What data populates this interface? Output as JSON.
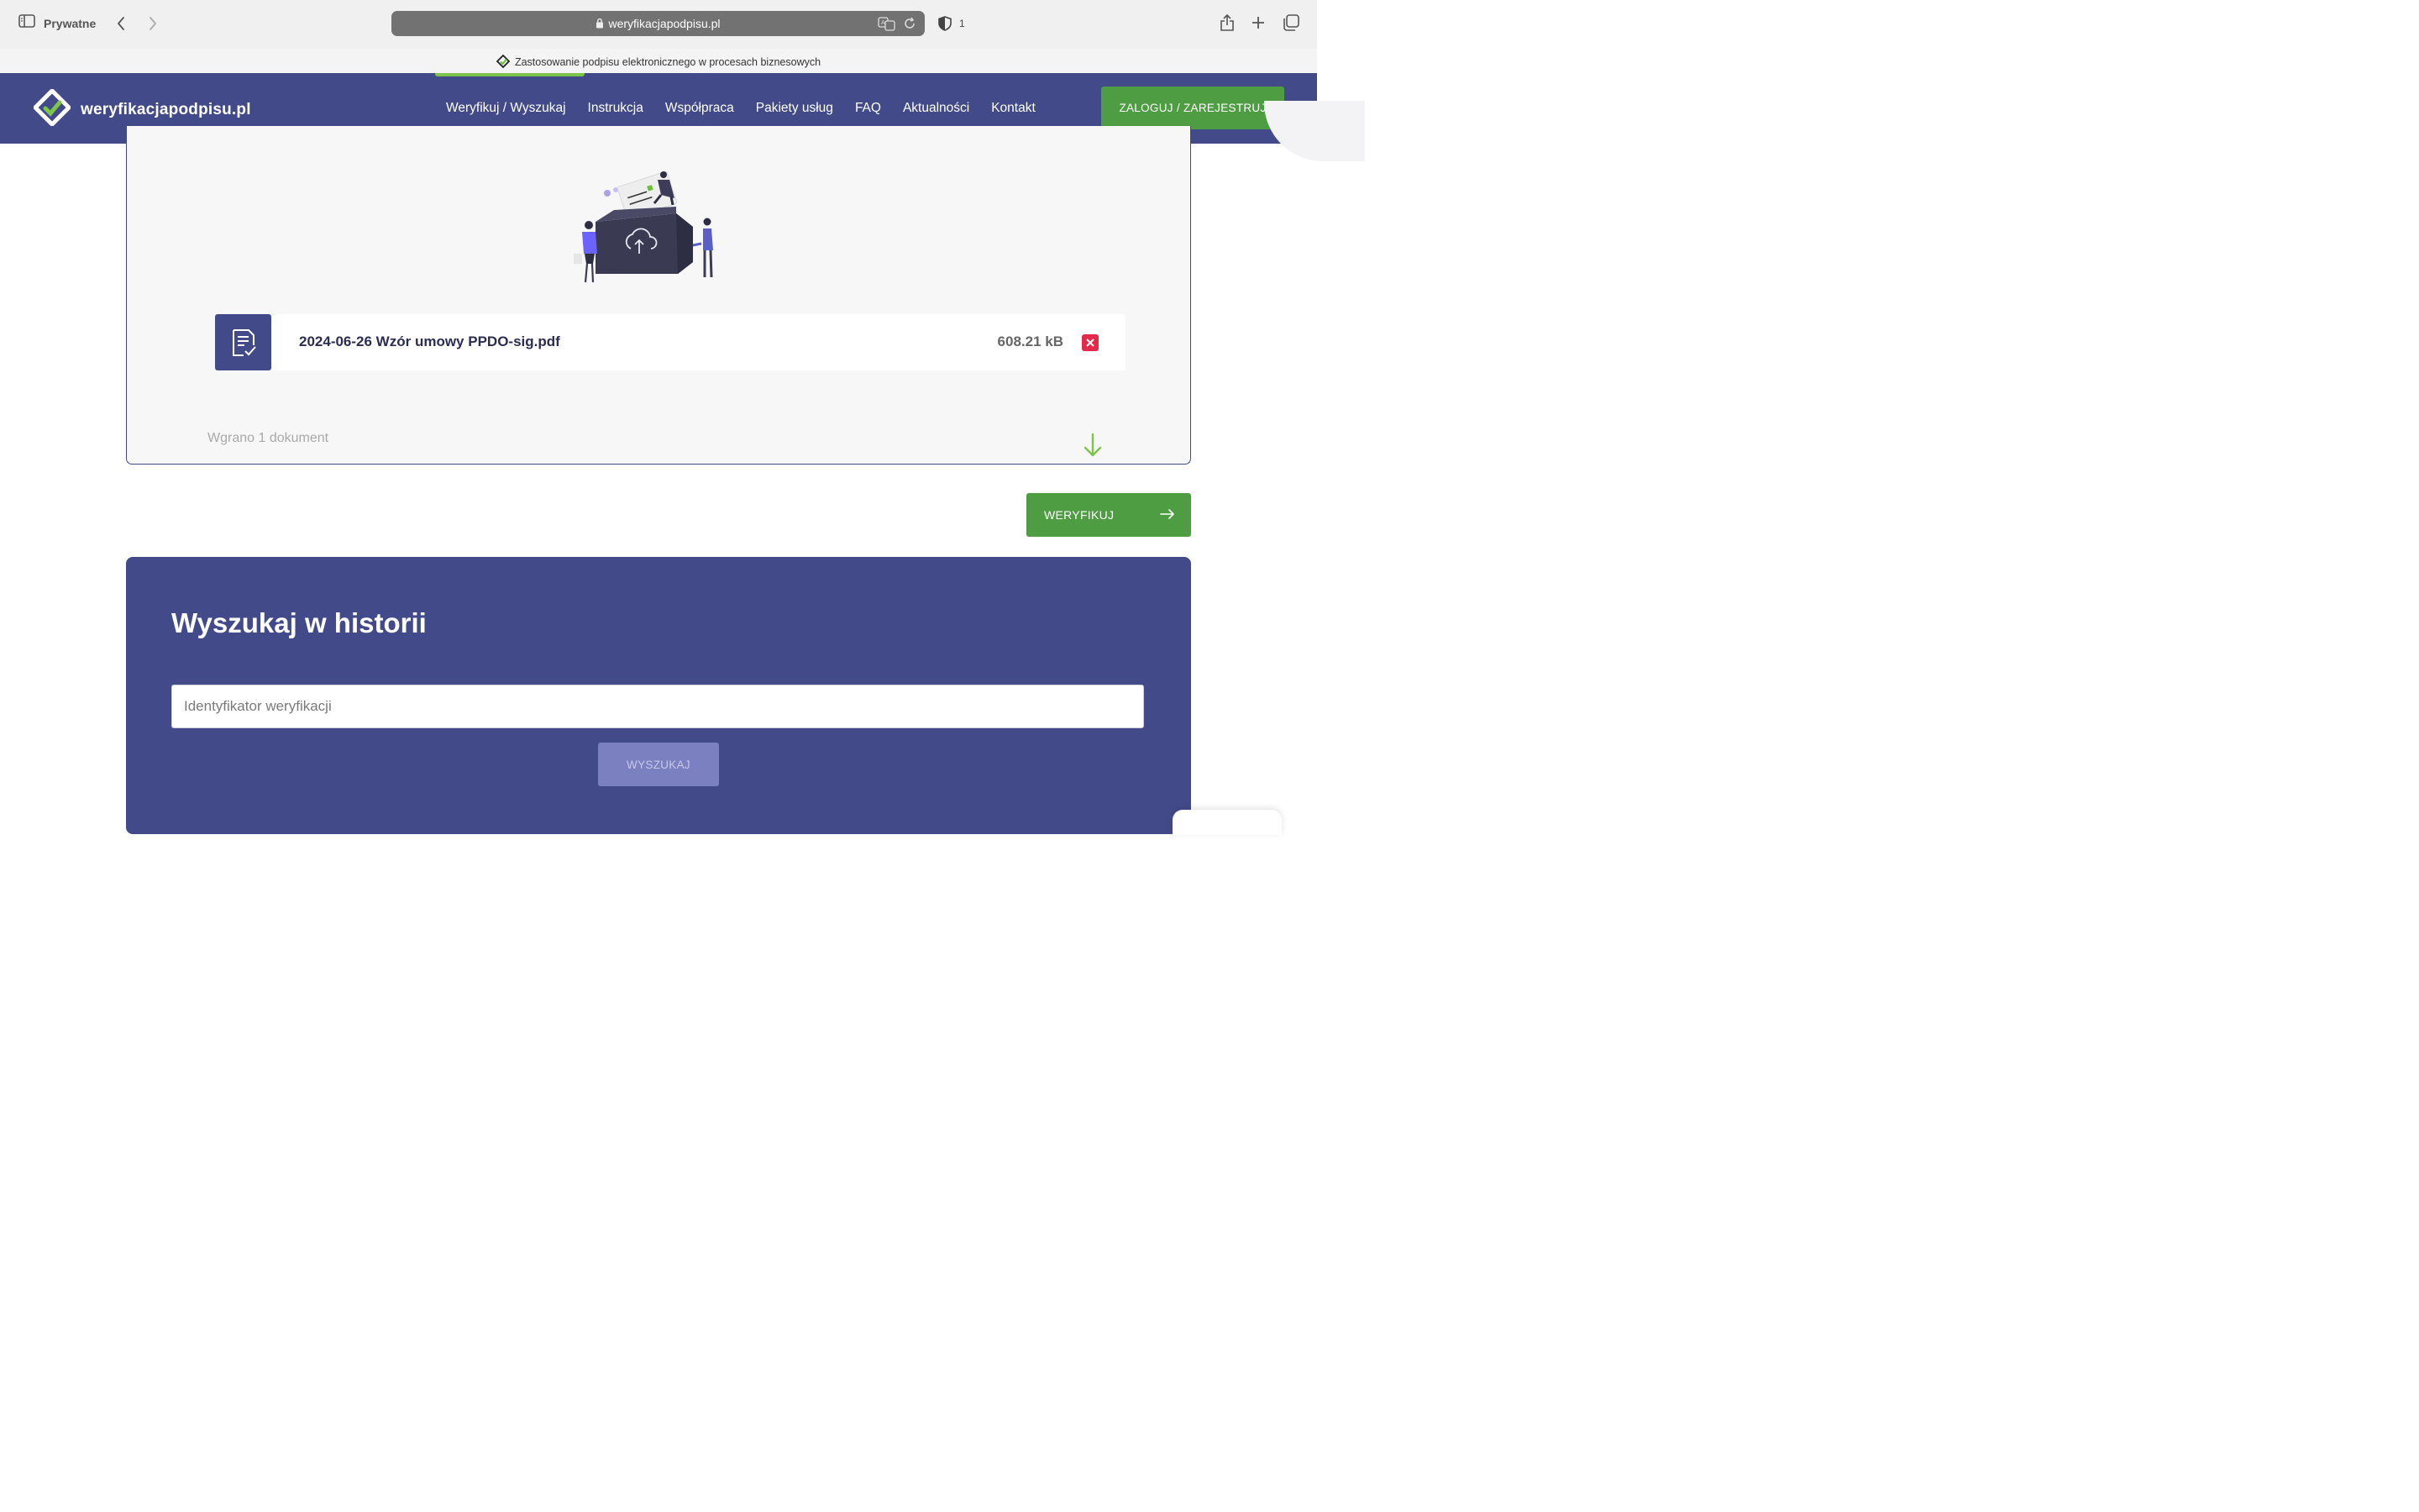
{
  "browser": {
    "profile_label": "Prywatne",
    "url": "weryfikacjapodpisu.pl",
    "shield_count": "1",
    "tab_title": "Zastosowanie podpisu elektronicznego w procesach biznesowych"
  },
  "site": {
    "brand": "weryfikacjapodpisu.pl",
    "nav": [
      {
        "label": "Weryfikuj / Wyszukaj"
      },
      {
        "label": "Instrukcja"
      },
      {
        "label": "Współpraca"
      },
      {
        "label": "Pakiety usług"
      },
      {
        "label": "FAQ"
      },
      {
        "label": "Aktualności"
      },
      {
        "label": "Kontakt"
      }
    ],
    "login_label": "ZALOGUJ / ZAREJESTRUJ"
  },
  "upload": {
    "file": {
      "name": "2024-06-26 Wzór umowy PPDO-sig.pdf",
      "size": "608.21 kB"
    },
    "status": "Wgrano 1 dokument"
  },
  "verify_label": "WERYFIKUJ",
  "history": {
    "title": "Wyszukaj w historii",
    "input_placeholder": "Identyfikator weryfikacji",
    "input_value": "",
    "search_label": "WYSZUKAJ"
  },
  "colors": {
    "brand_blue": "#434a8a",
    "brand_green": "#4e9d42",
    "accent_green": "#7cc44a",
    "delete_red": "#e5294a"
  }
}
